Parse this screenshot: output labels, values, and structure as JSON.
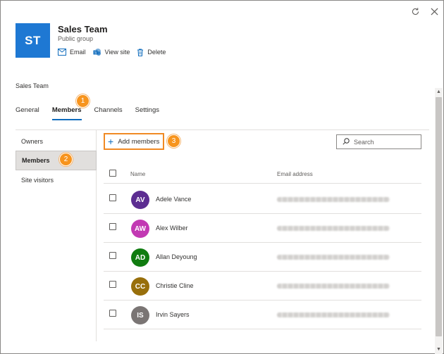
{
  "header": {
    "initials": "ST",
    "tile_color": "#1e78d3",
    "title": "Sales Team",
    "subtitle": "Public group",
    "actions": [
      {
        "label": "Email",
        "icon": "mail-icon"
      },
      {
        "label": "View site",
        "icon": "sharepoint-icon"
      },
      {
        "label": "Delete",
        "icon": "trash-icon"
      }
    ],
    "window_icons": [
      "refresh-icon",
      "close-icon"
    ]
  },
  "breadcrumb": "Sales Team",
  "tabs": [
    {
      "label": "General",
      "active": false
    },
    {
      "label": "Members",
      "active": true
    },
    {
      "label": "Channels",
      "active": false
    },
    {
      "label": "Settings",
      "active": false
    }
  ],
  "sidenav": [
    {
      "label": "Owners",
      "selected": false
    },
    {
      "label": "Members",
      "selected": true
    },
    {
      "label": "Site visitors",
      "selected": false
    }
  ],
  "callouts": {
    "tabs": "1",
    "sidenav": "2",
    "add": "3",
    "color": "#f7941d"
  },
  "toolbar": {
    "add_label": "Add members",
    "search_placeholder": "Search"
  },
  "table": {
    "columns": [
      "Name",
      "Email address"
    ],
    "rows": [
      {
        "initials": "AV",
        "name": "Adele Vance",
        "color": "#5c2d91"
      },
      {
        "initials": "AW",
        "name": "Alex Wilber",
        "color": "#c239b3"
      },
      {
        "initials": "AD",
        "name": "Allan Deyoung",
        "color": "#107c10"
      },
      {
        "initials": "CC",
        "name": "Christie Cline",
        "color": "#986f0b"
      },
      {
        "initials": "IS",
        "name": "Irvin Sayers",
        "color": "#7a7574"
      }
    ]
  }
}
